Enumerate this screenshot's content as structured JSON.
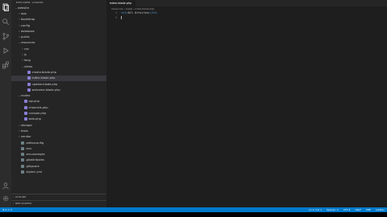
{
  "sidebar": {
    "title": "EXPLORER: LARAVEL",
    "tree": [
      {
        "label": "website",
        "kind": "folder",
        "open": true,
        "indent": 1
      },
      {
        "label": "app",
        "kind": "folder",
        "open": false,
        "indent": 2
      },
      {
        "label": "bootstrap",
        "kind": "folder",
        "open": false,
        "indent": 2
      },
      {
        "label": "config",
        "kind": "folder",
        "open": false,
        "indent": 2
      },
      {
        "label": "database",
        "kind": "folder",
        "open": false,
        "indent": 2
      },
      {
        "label": "public",
        "kind": "folder",
        "open": false,
        "indent": 2
      },
      {
        "label": "resources",
        "kind": "folder",
        "open": true,
        "indent": 2
      },
      {
        "label": "css",
        "kind": "folder",
        "open": false,
        "indent": 3
      },
      {
        "label": "js",
        "kind": "folder",
        "open": false,
        "indent": 3
      },
      {
        "label": "lang",
        "kind": "folder",
        "open": false,
        "indent": 3
      },
      {
        "label": "views",
        "kind": "folder",
        "open": true,
        "indent": 3
      },
      {
        "label": "create.blade.php",
        "kind": "file",
        "indent": 4
      },
      {
        "label": "index.blade.php",
        "kind": "file",
        "indent": 4,
        "selected": true
      },
      {
        "label": "update.blade.php",
        "kind": "file",
        "indent": 4
      },
      {
        "label": "welcome.blade.php",
        "kind": "file",
        "indent": 4
      },
      {
        "label": "routes",
        "kind": "folder",
        "open": true,
        "indent": 2
      },
      {
        "label": "api.php",
        "kind": "file",
        "indent": 3
      },
      {
        "label": "channels.php",
        "kind": "file",
        "indent": 3
      },
      {
        "label": "console.php",
        "kind": "file",
        "indent": 3
      },
      {
        "label": "web.php",
        "kind": "file",
        "indent": 3
      },
      {
        "label": "storage",
        "kind": "folder",
        "open": false,
        "indent": 2
      },
      {
        "label": "tests",
        "kind": "folder",
        "open": false,
        "indent": 2
      },
      {
        "label": "vendor",
        "kind": "folder",
        "open": false,
        "indent": 2
      },
      {
        "label": ".editorconfig",
        "kind": "file",
        "indent": 2
      },
      {
        "label": ".env",
        "kind": "file",
        "indent": 2
      },
      {
        "label": ".env.example",
        "kind": "file",
        "indent": 2
      },
      {
        "label": ".gitattributes",
        "kind": "file",
        "indent": 2
      },
      {
        "label": ".gitignore",
        "kind": "file",
        "indent": 2
      },
      {
        "label": ".styleci.yml",
        "kind": "file",
        "indent": 2
      }
    ],
    "outline_label": "OUTLINE",
    "npm_label": "NPM SCRIPTS"
  },
  "editor": {
    "tab_label": "index.blade.php",
    "breadcrumb": "resources › views › index.blade.php",
    "lines": [
      {
        "num": "1",
        "open": "<h1>",
        "text": "All Articles",
        "close": "</h1>"
      },
      {
        "num": "2",
        "open": "",
        "text": "",
        "close": ""
      }
    ]
  },
  "status": {
    "branch": "⊗ 0 ⚠ 0",
    "position": "Ln 2, Col 1",
    "spaces": "Spaces: 4",
    "encoding": "UTF-8",
    "eol": "CRLF",
    "language": "PHP",
    "extra": "prettier"
  },
  "colors": {
    "accent": "#007acc",
    "sidebar": "#252526",
    "editor": "#1e1e1e",
    "activity": "#2c2c2c",
    "folder_icon": "#c09553",
    "php_icon": "#8a7fd6"
  },
  "icons": [
    "files-icon",
    "search-icon",
    "source-control-icon",
    "debug-icon",
    "extensions-icon",
    "account-icon",
    "settings-gear-icon"
  ]
}
